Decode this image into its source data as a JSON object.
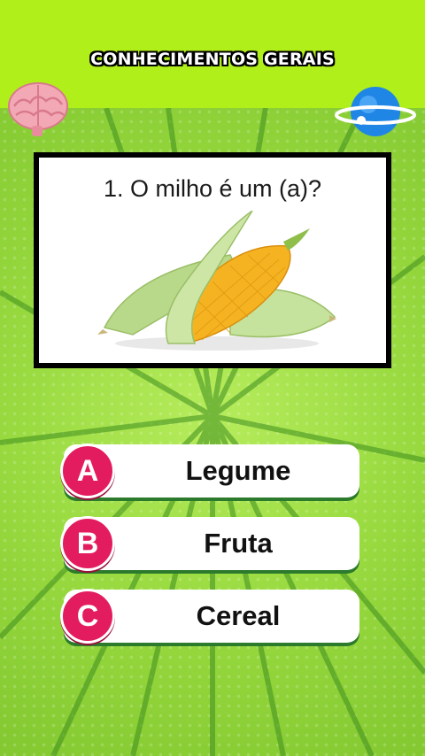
{
  "header": {
    "title": "CONHECIMENTOS GERAIS",
    "left_icon": "brain-icon",
    "right_icon": "planet-icon"
  },
  "question": {
    "text": "1. O milho é um (a)?",
    "image": "corn-illustration"
  },
  "answers": [
    {
      "letter": "A",
      "label": "Legume"
    },
    {
      "letter": "B",
      "label": "Fruta"
    },
    {
      "letter": "C",
      "label": "Cereal"
    }
  ],
  "colors": {
    "background": "#8fd13a",
    "header_band": "#b0ef1a",
    "answer_badge": "#e31c5f",
    "answer_bg": "#ffffff"
  }
}
